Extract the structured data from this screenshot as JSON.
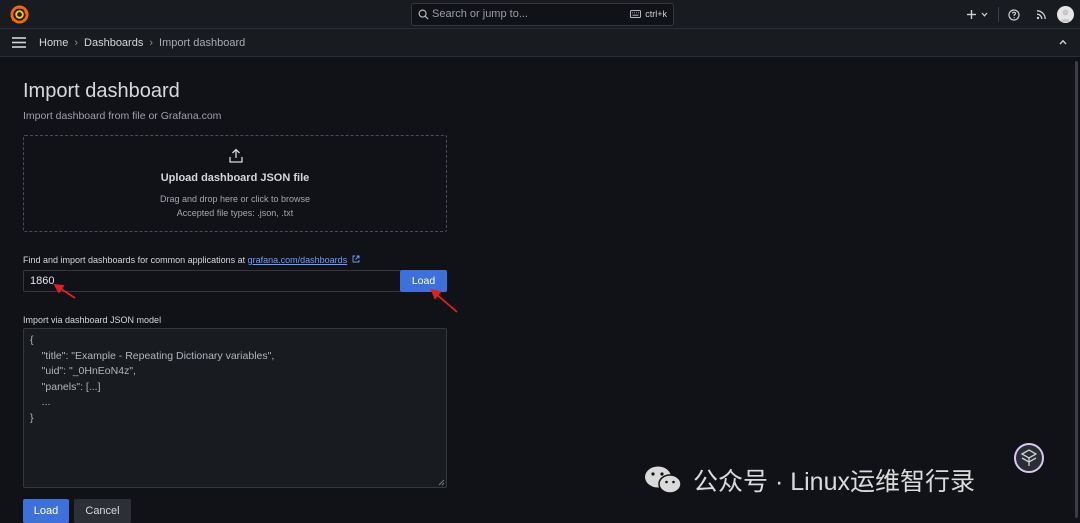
{
  "topbar": {
    "search_placeholder": "Search or jump to...",
    "shortcut": "ctrl+k",
    "icons": [
      "grafana-logo-icon",
      "search-icon",
      "keyboard-icon",
      "plus-icon",
      "chevron-down-icon",
      "help-icon",
      "news-rss-icon",
      "avatar"
    ]
  },
  "breadcrumb": {
    "items": [
      "Home",
      "Dashboards",
      "Import dashboard"
    ],
    "separator": "›"
  },
  "page": {
    "title": "Import dashboard",
    "subtitle": "Import dashboard from file or Grafana.com"
  },
  "upload": {
    "title": "Upload dashboard JSON file",
    "hint1": "Drag and drop here or click to browse",
    "hint2": "Accepted file types: .json, .txt"
  },
  "grafana_com": {
    "label": "Find and import dashboards for common applications at ",
    "link": "grafana.com/dashboards",
    "input_value": "1860",
    "load_label": "Load"
  },
  "json_model": {
    "label": "Import via dashboard JSON model",
    "lines": [
      "{",
      "    \"title\": \"Example - Repeating Dictionary variables\",",
      "    \"uid\": \"_0HnEoN4z\",",
      "    \"panels\": [...]",
      "    ...",
      "}"
    ]
  },
  "actions": {
    "load": "Load",
    "cancel": "Cancel"
  },
  "watermark": {
    "text": "公众号 · Linux运维智行录"
  },
  "colors": {
    "background": "#111217",
    "panel": "#181b1f",
    "primary": "#3d71d9",
    "link": "#6e9fff",
    "annotation_arrow": "#e02020"
  }
}
